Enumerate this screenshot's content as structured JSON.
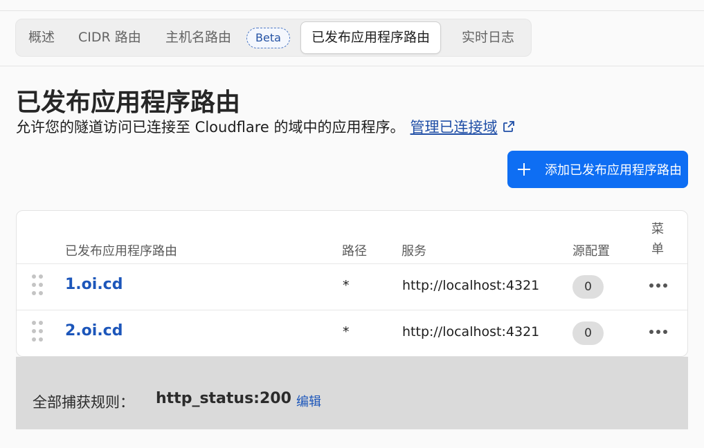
{
  "tabs": [
    {
      "label": "概述"
    },
    {
      "label": "CIDR 路由"
    },
    {
      "label": "主机名路由",
      "badge": "Beta"
    },
    {
      "label": "已发布应用程序路由",
      "active": true
    },
    {
      "label": "实时日志"
    }
  ],
  "page": {
    "title": "已发布应用程序路由",
    "description": "允许您的隧道访问已连接至 Cloudflare 的域中的应用程序。",
    "manage_link": "管理已连接域",
    "add_button": "添加已发布应用程序路由"
  },
  "table": {
    "headers": {
      "hostname": "已发布应用程序路由",
      "path": "路径",
      "service": "服务",
      "origin": "源配置",
      "menu": "菜单"
    },
    "rows": [
      {
        "hostname": "1.oi.cd",
        "path": "*",
        "service": "http://localhost:4321",
        "origin_count": "0"
      },
      {
        "hostname": "2.oi.cd",
        "path": "*",
        "service": "http://localhost:4321",
        "origin_count": "0"
      }
    ]
  },
  "catch_all": {
    "label": "全部捕获规则：",
    "value": "http_status:200",
    "edit": "编辑"
  },
  "colors": {
    "accent": "#0e6ef3",
    "link": "#1c56ba"
  }
}
